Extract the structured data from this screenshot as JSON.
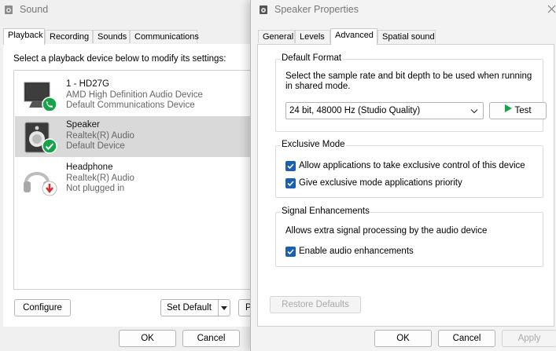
{
  "sound": {
    "title": "Sound",
    "tabs": [
      "Playback",
      "Recording",
      "Sounds",
      "Communications"
    ],
    "instruction": "Select a playback device below to modify its settings:",
    "devices": [
      {
        "name": "1 - HD27G",
        "line2": "AMD High Definition Audio Device",
        "line3": "Default Communications Device"
      },
      {
        "name": "Speaker",
        "line2": "Realtek(R) Audio",
        "line3": "Default Device"
      },
      {
        "name": "Headphone",
        "line2": "Realtek(R) Audio",
        "line3": "Not plugged in"
      }
    ],
    "configure_label": "Configure",
    "set_default_label": "Set Default",
    "properties_label_partial": "Pr",
    "ok_label": "OK",
    "cancel_label": "Cancel"
  },
  "props": {
    "title": "Speaker Properties",
    "tabs": [
      "General",
      "Levels",
      "Advanced",
      "Spatial sound"
    ],
    "default_format": {
      "title": "Default Format",
      "description_line1": "Select the sample rate and bit depth to be used when running",
      "description_line2": "in shared mode.",
      "selected": "24 bit, 48000 Hz (Studio Quality)",
      "test_label": "Test"
    },
    "exclusive_mode": {
      "title": "Exclusive Mode",
      "option1": "Allow applications to take exclusive control of this device",
      "option2": "Give exclusive mode applications priority"
    },
    "signal_enhancements": {
      "title": "Signal Enhancements",
      "description": "Allows extra signal processing by the audio device",
      "option1": "Enable audio enhancements"
    },
    "restore_label": "Restore Defaults",
    "ok_label": "OK",
    "cancel_label": "Cancel",
    "apply_label": "Apply"
  },
  "colors": {
    "accent": "#1a5fb4",
    "check_green": "#16a34a",
    "unplugged_red": "#d32f2f"
  }
}
